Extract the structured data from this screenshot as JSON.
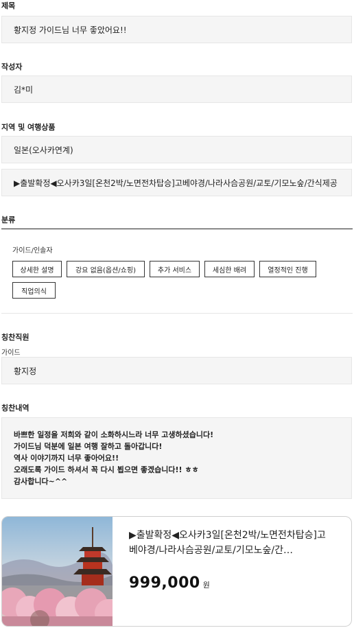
{
  "title_section": {
    "label": "제목",
    "value": "황지정 가이드님 너무 좋았어요!!"
  },
  "author_section": {
    "label": "작성자",
    "value": "김*미"
  },
  "region_section": {
    "label": "지역 및 여행상품",
    "region": "일본(오사카연계)",
    "product": "▶출발확정◀오사카3일[온천2박/노면전차탑승]고베야경/나라사슴공원/교토/기모노숲/간식제공"
  },
  "category_section": {
    "label": "분류",
    "subheading": "가이드/인솔자",
    "tags": [
      "상세한 설명",
      "강요 없음(옵션/쇼핑)",
      "추가 서비스",
      "세심한 배려",
      "열정적인 진행",
      "직업의식"
    ]
  },
  "staff_section": {
    "label": "칭찬직원",
    "role": "가이드",
    "name": "황지정"
  },
  "praise_section": {
    "label": "칭찬내역",
    "lines": [
      "바쁘한 일정을 저희와 같이 소화하시느라 너무 고생하셨습니다!",
      "가이드님 덕분에 일본 여행 잘하고 돌아갑니다!",
      "역사 이야기까지 너무 좋아어요!!",
      "오래도록 가이드 하셔서 꼭 다시 뵙으면 좋겠습니다!! ㅎㅎ",
      "감사합니다~^^"
    ]
  },
  "product_card": {
    "title": "▶출발확정◀오사카3일[온천2박/노면전차탑승]고베야경/나라사슴공원/교토/기모노숲/간…",
    "price": "999,000",
    "currency": "원"
  },
  "colors": {
    "field_bg": "#f5f5f5",
    "border": "#e6e6e6",
    "text": "#222222"
  },
  "icons": {
    "card_image": "pagoda-cherry-blossom-photo"
  }
}
